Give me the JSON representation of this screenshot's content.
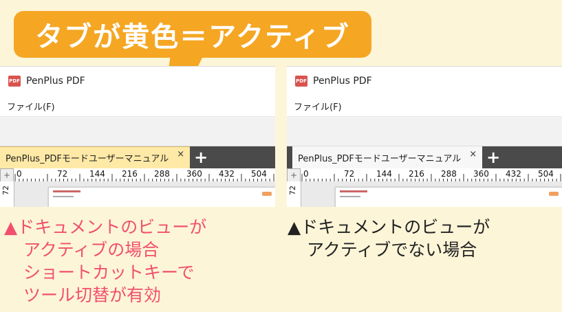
{
  "callout": {
    "text": "タブが黄色＝アクティブ",
    "color": "#f5a623"
  },
  "windows": [
    {
      "title": "PenPlus PDF",
      "app_icon_text": "PDF",
      "menu": "ファイル(F)",
      "tab_label": "PenPlus_PDFモードユーザーマニュアル",
      "tab_state": "active",
      "close": "×",
      "add_tab": "+",
      "ruler_ticks": [
        "0",
        "72",
        "144",
        "216",
        "288",
        "360",
        "432",
        "504"
      ],
      "ruler_corner": "+",
      "vertical_ruler": "72"
    },
    {
      "title": "PenPlus PDF",
      "app_icon_text": "PDF",
      "menu": "ファイル(F)",
      "tab_label": "PenPlus_PDFモードユーザーマニュアル",
      "tab_state": "inactive",
      "close": "×",
      "add_tab": "+",
      "ruler_ticks": [
        "0",
        "72",
        "144",
        "216",
        "288",
        "360",
        "432",
        "504"
      ],
      "ruler_corner": "+",
      "vertical_ruler": "72"
    }
  ],
  "captions": {
    "left": [
      "▲ドキュメントのビューが",
      "アクティブの場合",
      "ショートカットキーで",
      "ツール切替が有効"
    ],
    "right": [
      "▲ドキュメントのビューが",
      "アクティブでない場合"
    ]
  },
  "colors": {
    "background": "#fdf5d8",
    "active_tab": "#ffe9a6",
    "left_caption": "#f0506e",
    "tabstrip": "#4a4a4a"
  }
}
